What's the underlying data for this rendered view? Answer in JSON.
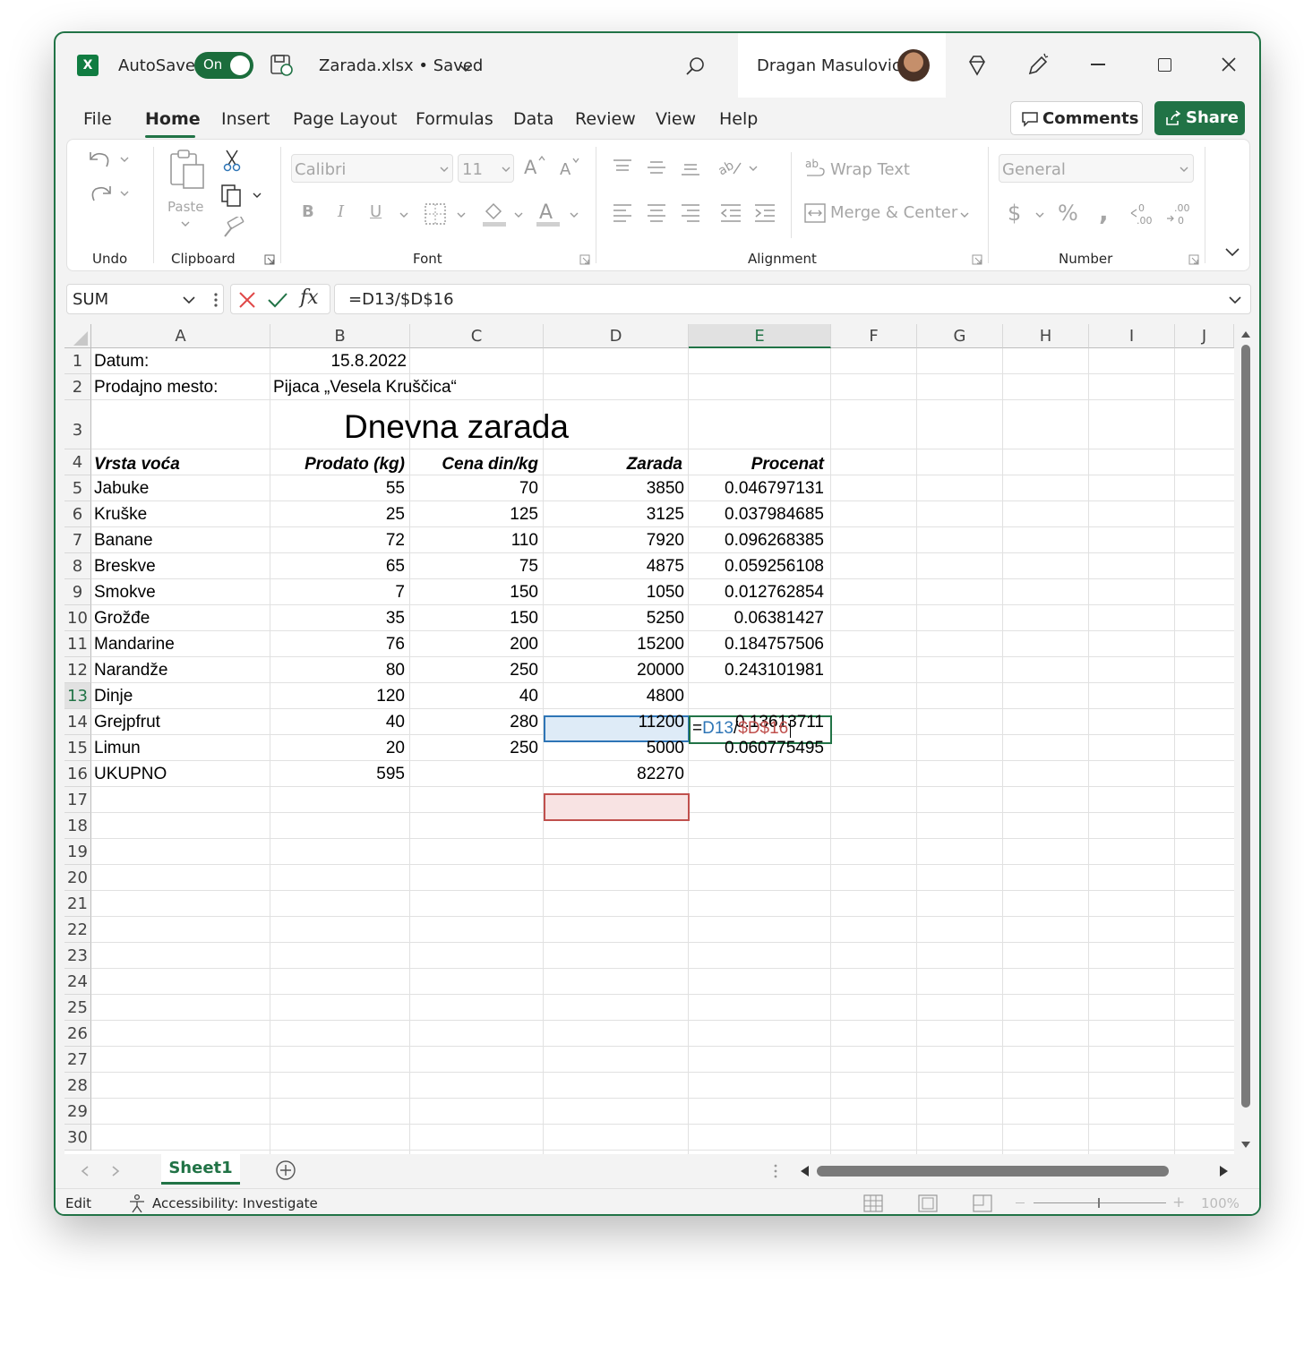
{
  "titlebar": {
    "app_icon": "X",
    "autosave_label": "AutoSave",
    "toggle_label": "On",
    "filename": "Zarada.xlsx • Saved",
    "user_name": "Dragan Masulovic"
  },
  "menu": [
    "File",
    "Home",
    "Insert",
    "Page Layout",
    "Formulas",
    "Data",
    "Review",
    "View",
    "Help"
  ],
  "actions": {
    "comments": "Comments",
    "share": "Share"
  },
  "ribbon": {
    "groups": [
      "Undo",
      "Clipboard",
      "Font",
      "Alignment",
      "Number"
    ],
    "paste": "Paste",
    "font_name": "Calibri",
    "font_size": "11",
    "wrap_text": "Wrap Text",
    "merge_center": "Merge & Center",
    "number_format": "General"
  },
  "formula_bar": {
    "name_box": "SUM",
    "formula": "=D13/$D$16"
  },
  "columns": [
    "A",
    "B",
    "C",
    "D",
    "E",
    "F",
    "G",
    "H",
    "I",
    "J"
  ],
  "rows": [
    "1",
    "2",
    "3",
    "4",
    "5",
    "6",
    "7",
    "8",
    "9",
    "10",
    "11",
    "12",
    "13",
    "14",
    "15",
    "16",
    "17",
    "18",
    "19",
    "20",
    "21",
    "22",
    "23",
    "24",
    "25",
    "26",
    "27",
    "28",
    "29",
    "30"
  ],
  "cells": {
    "A1": "Datum:",
    "B1": "15.8.2022",
    "A2": "Prodajno mesto:",
    "B2": "Pijaca „Vesela Kruščica“",
    "title": "Dnevna zarada",
    "A4": "Vrsta voća",
    "B4": "Prodato (kg)",
    "C4": "Cena din/kg",
    "D4": "Zarada",
    "E4": "Procenat"
  },
  "table": [
    {
      "a": "Jabuke",
      "b": "55",
      "c": "70",
      "d": "3850",
      "e": "0.046797131"
    },
    {
      "a": "Kruške",
      "b": "25",
      "c": "125",
      "d": "3125",
      "e": "0.037984685"
    },
    {
      "a": "Banane",
      "b": "72",
      "c": "110",
      "d": "7920",
      "e": "0.096268385"
    },
    {
      "a": "Breskve",
      "b": "65",
      "c": "75",
      "d": "4875",
      "e": "0.059256108"
    },
    {
      "a": "Smokve",
      "b": "7",
      "c": "150",
      "d": "1050",
      "e": "0.012762854"
    },
    {
      "a": "Grožđe",
      "b": "35",
      "c": "150",
      "d": "5250",
      "e": "0.06381427"
    },
    {
      "a": "Mandarine",
      "b": "76",
      "c": "200",
      "d": "15200",
      "e": "0.184757506"
    },
    {
      "a": "Narandže",
      "b": "80",
      "c": "250",
      "d": "20000",
      "e": "0.243101981"
    },
    {
      "a": "Dinje",
      "b": "120",
      "c": "40",
      "d": "4800",
      "e": ""
    },
    {
      "a": "Grejpfrut",
      "b": "40",
      "c": "280",
      "d": "11200",
      "e": "0.13613711"
    },
    {
      "a": "Limun",
      "b": "20",
      "c": "250",
      "d": "5000",
      "e": "0.060775495"
    },
    {
      "a": "UKUPNO",
      "b": "595",
      "c": "",
      "d": "82270",
      "e": ""
    }
  ],
  "edit_cell": {
    "eq": "=",
    "ref1": "D13",
    "slash": "/",
    "ref2": "$D$16"
  },
  "sheet_tab": "Sheet1",
  "status": {
    "mode": "Edit",
    "accessibility": "Accessibility: Investigate",
    "zoom": "100%"
  },
  "colors": {
    "accent": "#217346",
    "ref_blue": "#2e75b6",
    "ref_red": "#c0504d"
  }
}
